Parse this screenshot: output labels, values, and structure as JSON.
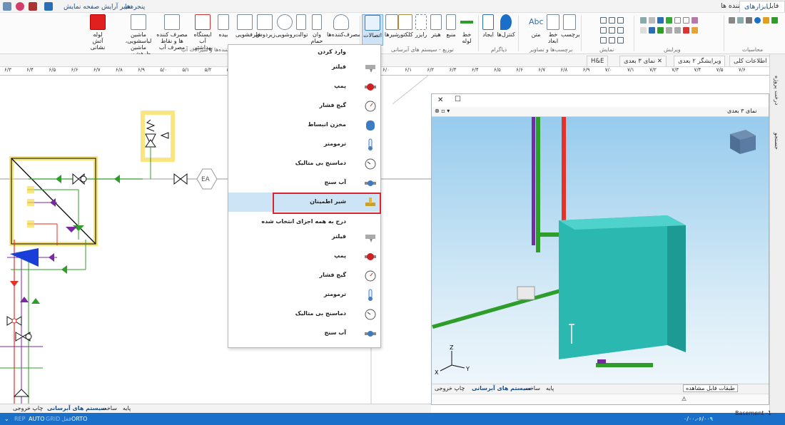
{
  "quick_access": {
    "windows_dropdown": "پنجره‌ها",
    "layout_dropdown": "تغییر آرایش صفحه نمایش"
  },
  "ribbon_tabs": [
    "فایل",
    "ابزارهای اصلی",
    "مصرف‌کننده ها"
  ],
  "ribbon": {
    "buttons": [
      {
        "label": "لوله آتش نشانی",
        "icon": "fire-pipe-icon"
      },
      {
        "label": "ماشین لباسشویی، ماشین ظرفشویی",
        "icon": "washing-machine-icon"
      },
      {
        "label": "مصرف کننده ها و نقاط مصرف آب",
        "icon": "faucet-icon"
      },
      {
        "label": "ایستگاه آب بهداشتی",
        "icon": "water-station-icon"
      },
      {
        "label": "بیده",
        "icon": "bidet-icon"
      },
      {
        "label": "ظرفشویی",
        "icon": "sink-icon"
      },
      {
        "label": "زیردوش",
        "icon": "shower-tray-icon"
      },
      {
        "label": "روشویی",
        "icon": "washbasin-icon"
      },
      {
        "label": "توالت",
        "icon": "toilet-icon"
      },
      {
        "label": "وان حمام",
        "icon": "bathtub-icon"
      },
      {
        "label": "مصرف‌کننده‌ها",
        "icon": "consumers-icon"
      },
      {
        "label": "اتصالات",
        "icon": "fittings-icon"
      },
      {
        "label": "شیرها",
        "icon": "valves-icon"
      },
      {
        "label": "کلکتور",
        "icon": "collector-icon"
      },
      {
        "label": "رایزر",
        "icon": "riser-icon"
      },
      {
        "label": "هیتر",
        "icon": "heater-icon"
      },
      {
        "label": "منبع",
        "icon": "tank-icon"
      },
      {
        "label": "خط لوله",
        "icon": "pipeline-icon"
      },
      {
        "label": "ایجاد",
        "icon": "create-icon"
      },
      {
        "label": "کنترل‌ها",
        "icon": "controls-icon"
      },
      {
        "label": "متن",
        "icon": "text-icon"
      },
      {
        "label": "خط ابعاد",
        "icon": "dimension-icon"
      },
      {
        "label": "برچسب",
        "icon": "label-icon"
      }
    ],
    "groups": {
      "consumers": "مصرف‌کننده‌ها و شیرآلات آب",
      "distribution": "توزیع - سیستم های آبرسانی",
      "diagram": "دیاگرام",
      "labels": "برچسب‌ها و تصاویر",
      "view": "نمایش",
      "edit": "ویرایش",
      "calc": "محاسبات"
    }
  },
  "doc_tabs": [
    {
      "label": "اطلاعات کلی",
      "active": false
    },
    {
      "label": "ویرایشگر ۲ بعدی",
      "active": true
    },
    {
      "label": "نمای ۳ بعدی",
      "active": false
    },
    {
      "label": "H&E",
      "active": false
    }
  ],
  "ruler_ticks": [
    "۶/۳",
    "۶/۴",
    "۶/۵",
    "۶/۶",
    "۶/۷",
    "۶/۸",
    "۶/۹",
    "۵/۰",
    "۵/۱",
    "۵/۲",
    "۵/۳",
    "۵/۴",
    "۵/۵",
    "۵/۶",
    "۵/۷",
    "۵/۸",
    "۵/۹",
    "۶/۰",
    "۶/۱",
    "۶/۲",
    "۶/۳",
    "۶/۴",
    "۶/۵",
    "۶/۶",
    "۶/۷",
    "۶/۸",
    "۶/۹",
    "۷/۰",
    "۷/۱",
    "۷/۲",
    "۷/۳",
    "۷/۴",
    "۷/۵",
    "۷/۶"
  ],
  "canvas_labels": {
    "ea": "EA"
  },
  "context_menu": {
    "section1": "وارد کردن",
    "items1": [
      {
        "label": "فیلتر",
        "icon": "filter-icon"
      },
      {
        "label": "پمپ",
        "icon": "pump-icon"
      },
      {
        "label": "گیج فشار",
        "icon": "pressure-gauge-icon"
      },
      {
        "label": "مخزن انبساط",
        "icon": "expansion-tank-icon"
      },
      {
        "label": "ترمومتر",
        "icon": "thermometer-icon"
      },
      {
        "label": "دماسنج بی متالیک",
        "icon": "bimetal-thermometer-icon"
      },
      {
        "label": "آب سنج",
        "icon": "water-meter-icon"
      },
      {
        "label": "شیر اطمینان",
        "icon": "safety-valve-icon"
      }
    ],
    "section2": "درج به همه اجزای انتخاب شده",
    "items2": [
      {
        "label": "فیلتر",
        "icon": "filter-icon"
      },
      {
        "label": "پمپ",
        "icon": "pump-icon"
      },
      {
        "label": "گیج فشار",
        "icon": "pressure-gauge-icon"
      },
      {
        "label": "ترمومتر",
        "icon": "thermometer-icon"
      },
      {
        "label": "دماسنج بی متالیک",
        "icon": "bimetal-thermometer-icon"
      },
      {
        "label": "آب سنج",
        "icon": "water-meter-icon"
      }
    ]
  },
  "view3d": {
    "title": "نمای ۳ بعدی",
    "footer_tabs": [
      "چاپ خروجی",
      "سیستم های آبرسانی",
      "ساخت",
      "پایه"
    ],
    "footer_active": "سیستم های آبرسانی",
    "layer_dropdown": "طبقات قابل مشاهده",
    "axis_labels": {
      "z": "Z",
      "x": "X",
      "y": "Y"
    }
  },
  "bottom_tabs": [
    "چاپ خروجی",
    "سیستم های آبرسانی",
    "ساخت",
    "پایه"
  ],
  "bottom_active": "سیستم های آبرسانی",
  "status": {
    "modes": [
      "REP",
      "AUTO",
      "GRID",
      "قفل",
      "ORTO"
    ],
    "coords": "۰/۰۰،-۶/۰۰۹",
    "level": "Basement -1"
  },
  "right_panel": [
    "درخت پروژه",
    "جستجو"
  ],
  "colors": {
    "accent": "#1a70c9",
    "highlight": "#d9242c",
    "selection_glow": "#f6dc4a",
    "green_pipe": "#2e9d2a",
    "red_pipe": "#e53127",
    "purple_pipe": "#7a2aa0",
    "tank": "#2fc0b8"
  }
}
